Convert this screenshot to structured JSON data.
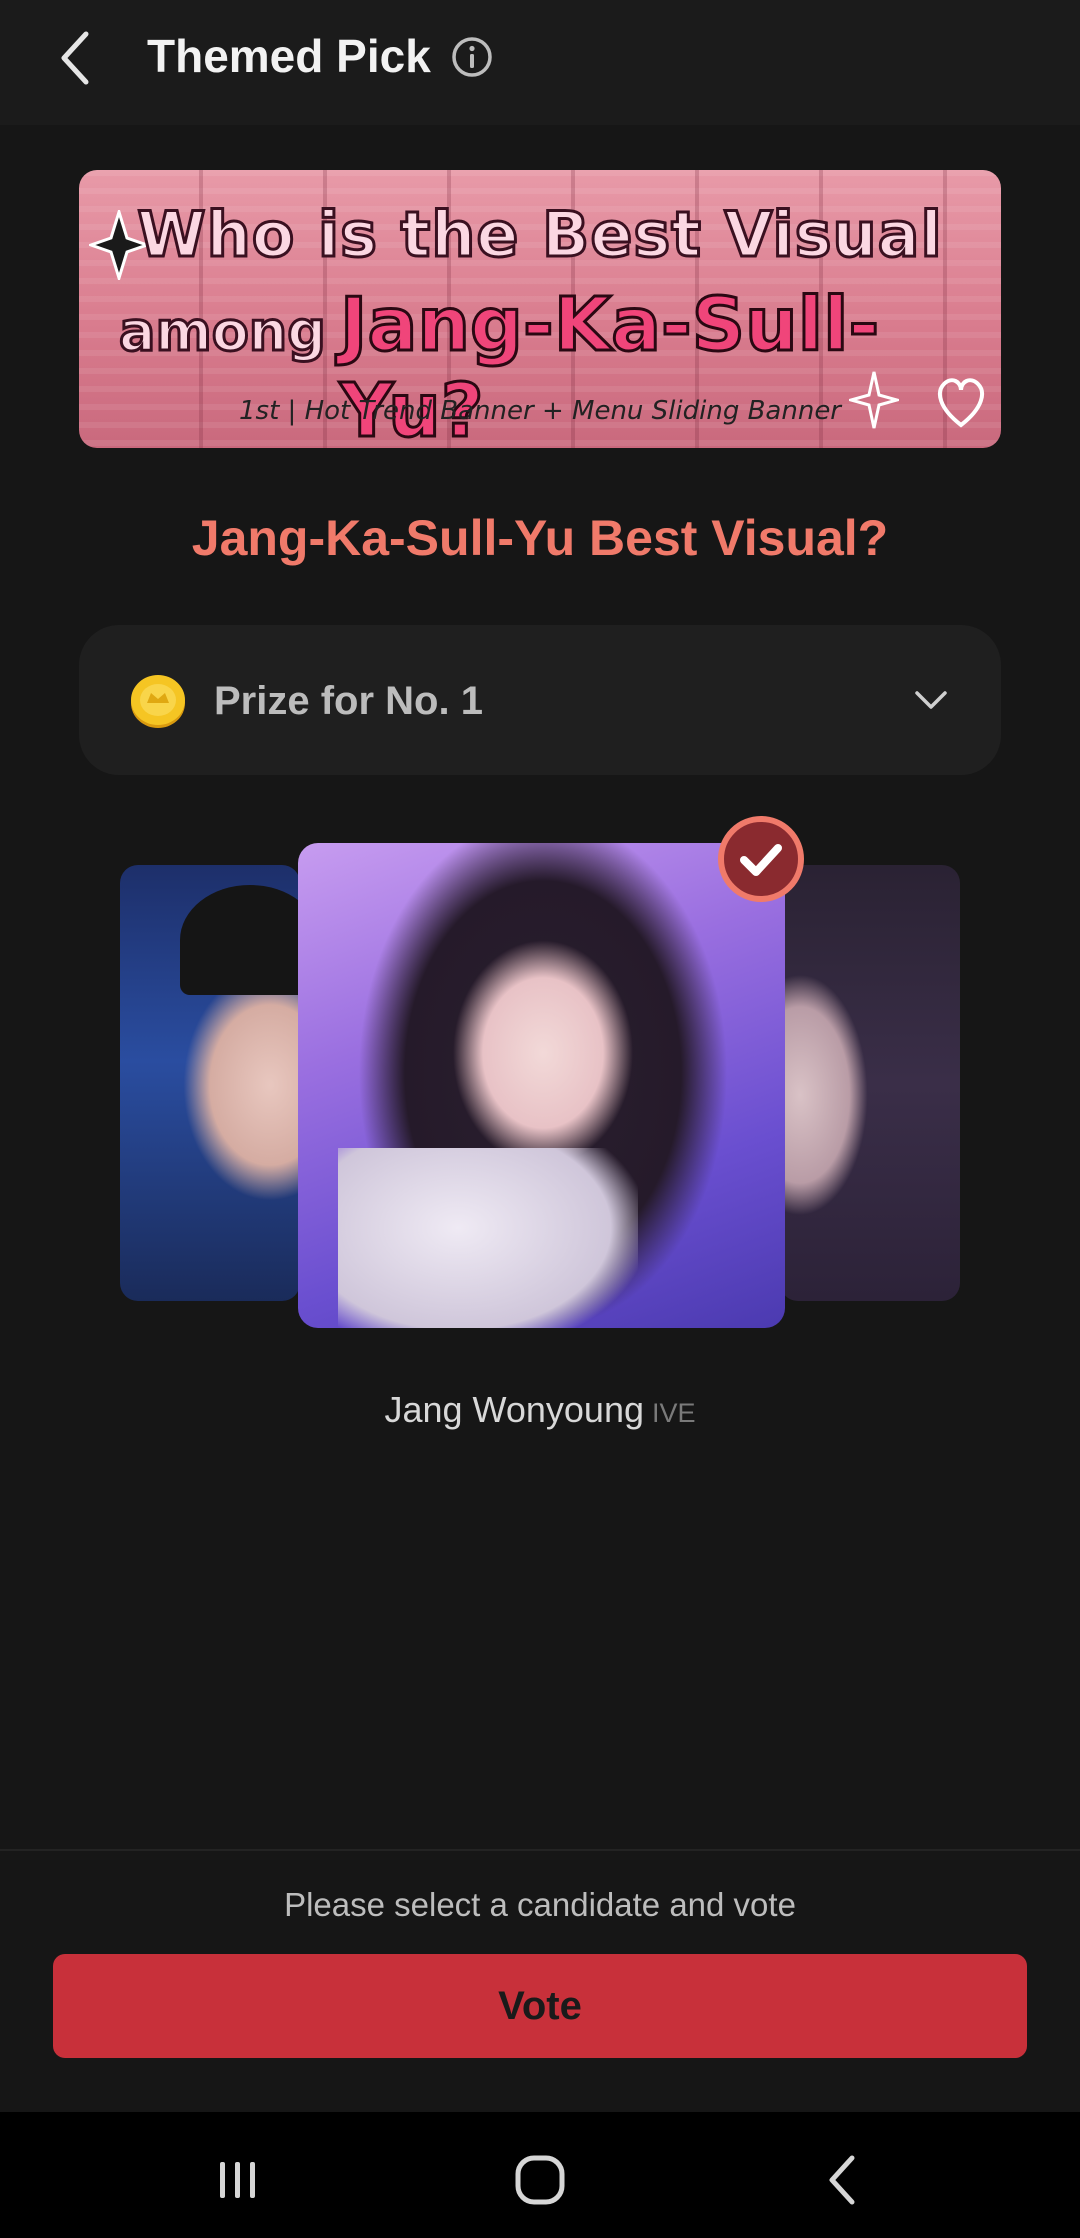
{
  "header": {
    "title": "Themed Pick"
  },
  "banner": {
    "line1": "Who is the Best Visual",
    "line2_prefix": "among",
    "line2_names": "Jang-Ka-Sull-Yu?",
    "subtitle": "1st | Hot Trend Banner + Menu Sliding Banner"
  },
  "pick": {
    "title": "Jang-Ka-Sull-Yu  Best Visual?"
  },
  "prize": {
    "label": "Prize for No. 1"
  },
  "candidate": {
    "name": "Jang Wonyoung",
    "group": "IVE"
  },
  "footer": {
    "hint": "Please select a candidate and vote",
    "vote_label": "Vote"
  },
  "colors": {
    "accent": "#f07a6a",
    "vote_button": "#c8303a",
    "background": "#161616"
  },
  "icons": {
    "back": "chevron-left-icon",
    "info": "info-icon",
    "coin": "coin-icon",
    "expand": "chevron-down-icon",
    "selected": "check-circle-icon",
    "nav_recents": "recents-icon",
    "nav_home": "home-icon",
    "nav_back": "back-icon"
  }
}
